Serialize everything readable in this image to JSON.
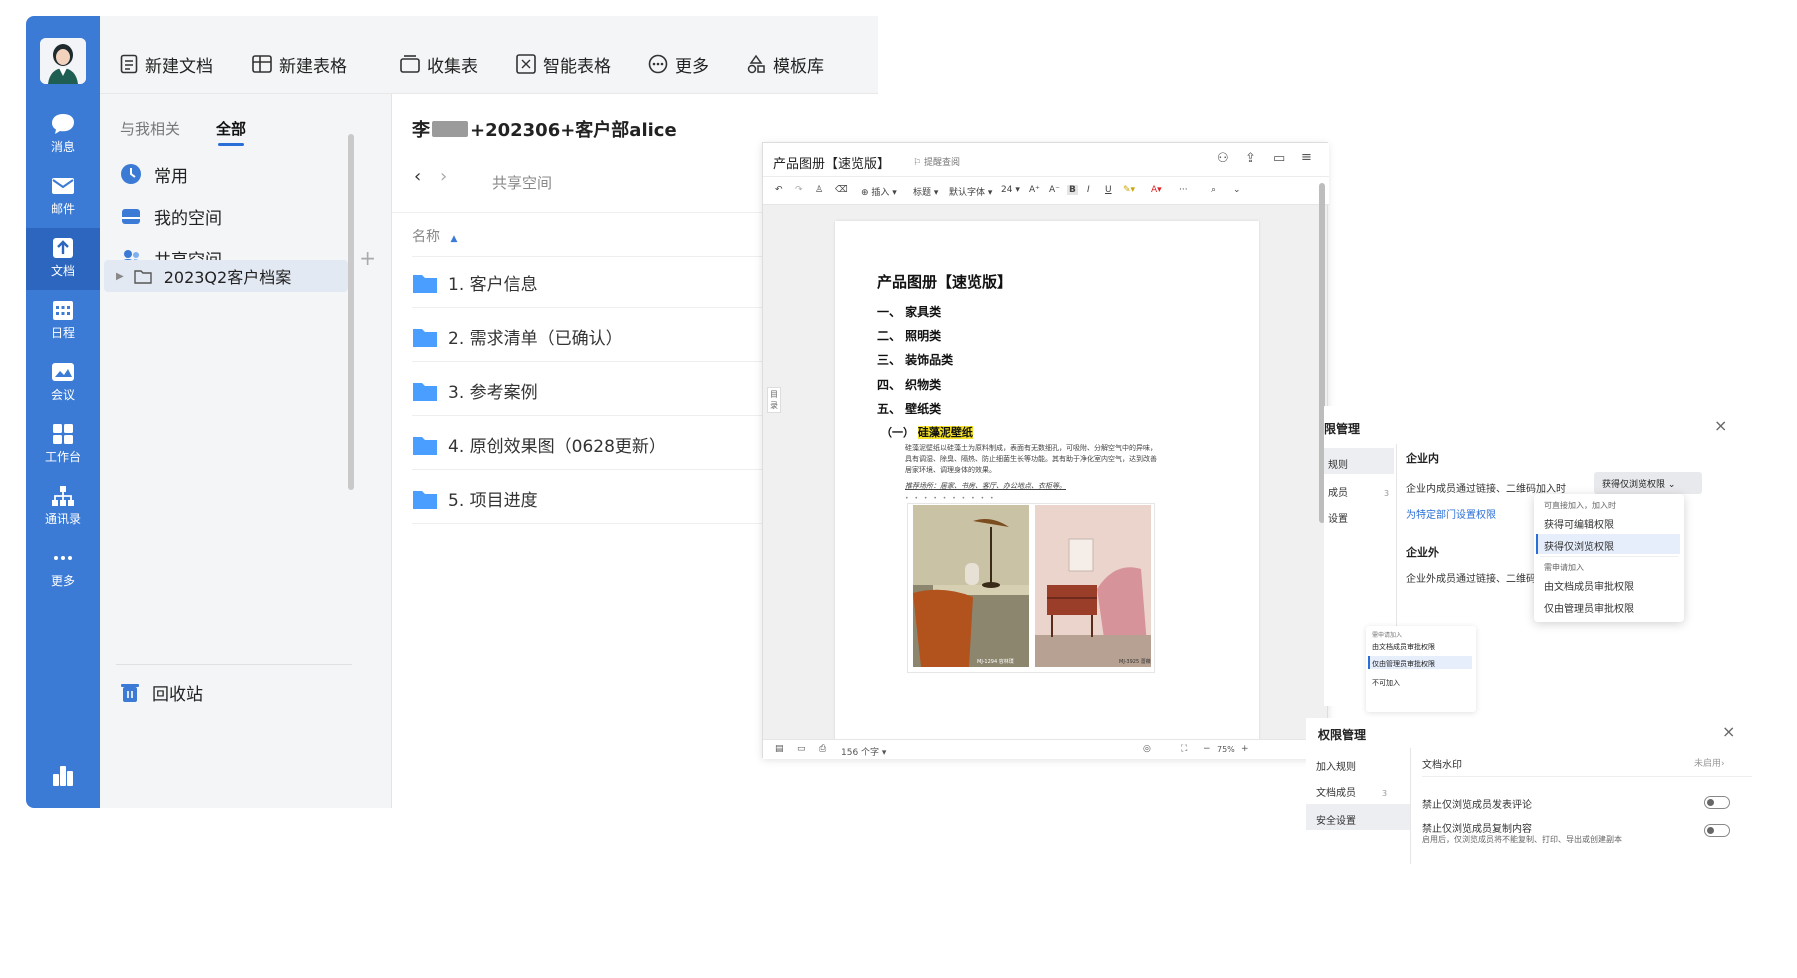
{
  "rail": {
    "items": [
      {
        "label": "消息",
        "icon": "chat-icon"
      },
      {
        "label": "邮件",
        "icon": "mail-icon"
      },
      {
        "label": "文档",
        "icon": "doc-icon"
      },
      {
        "label": "日程",
        "icon": "calendar-icon"
      },
      {
        "label": "会议",
        "icon": "meeting-icon"
      },
      {
        "label": "工作台",
        "icon": "grid-icon"
      },
      {
        "label": "通讯录",
        "icon": "contacts-icon"
      },
      {
        "label": "更多",
        "icon": "more-icon"
      }
    ],
    "active": "文档"
  },
  "toolbar": {
    "new_doc": "新建文档",
    "new_sheet": "新建表格",
    "collect": "收集表",
    "smart_sheet": "智能表格",
    "more": "更多",
    "templates": "模板库"
  },
  "left": {
    "tabs": [
      "与我相关",
      "全部"
    ],
    "active_tab": "全部",
    "common": "常用",
    "my_space": "我的空间",
    "shared_space": "共享空间",
    "folder": "2023Q2客户档案",
    "trash": "回收站"
  },
  "right": {
    "title_prefix": "李",
    "title_suffix": "+202306+客户部alice",
    "breadcrumb": "共享空间",
    "col_name": "名称",
    "files": [
      "1. 客户信息",
      "2. 需求清单（已确认）",
      "3. 参考案例",
      "4. 原创效果图（0628更新）",
      "5. 项目进度"
    ]
  },
  "doc": {
    "tab_title": "产品图册【速览版】",
    "tab_tag": "提醒查阅",
    "fmt": {
      "insert": "插入",
      "heading": "标题",
      "font": "默认字体",
      "size": "24"
    },
    "toc": "目录",
    "title": "产品图册【速览版】",
    "sections": [
      "一、 家具类",
      "二、 照明类",
      "三、 装饰品类",
      "四、 织物类",
      "五、 壁纸类"
    ],
    "sub": "（一）",
    "sub_hl": "硅藻泥壁纸",
    "body": "硅藻泥壁纸以硅藻土为原料制成，表面有无数细孔，可吸附、分解空气中的异味，具有调湿、除臭、隔热、防止细菌生长等功能。其有助于净化室内空气，达到改善居家环境、调理身体的效果。",
    "recommend": "推荐场所：居家、书房、客厅、办公地点、衣柜等。",
    "img1_tag": "MJ-1294 容林璞",
    "img2_tag": "MJ-3925 蔷薇",
    "word_count": "156 个字",
    "zoom": "75%"
  },
  "perm1": {
    "title": "限管理",
    "nav": [
      "规则",
      "成员",
      "设置"
    ],
    "nav_count": "3",
    "inside": "企业内",
    "inside_desc": "企业内成员通过链接、二维码加入时",
    "select": "获得仅浏览权限",
    "dept_link": "为特定部门设置权限",
    "outside": "企业外",
    "outside_desc": "企业外成员通过链接、二维码加入",
    "dd_group1": "可直接加入，加入时",
    "dd_opt1": "获得可编辑权限",
    "dd_opt2": "获得仅浏览权限",
    "dd_group2": "需申请加入",
    "dd_opt3": "由文档成员审批权限",
    "dd_opt4": "仅由管理员审批权限",
    "dd2_group": "需申请加入",
    "dd2_opt1": "由文档成员审批权限",
    "dd2_opt2": "仅由管理员审批权限",
    "dd2_opt3": "不可加入"
  },
  "perm2": {
    "title": "权限管理",
    "nav": [
      "加入规则",
      "文档成员",
      "安全设置"
    ],
    "nav_count": "3",
    "watermark": "文档水印",
    "watermark_state": "未启用",
    "opt1": "禁止仅浏览成员发表评论",
    "opt2": "禁止仅浏览成员复制内容",
    "opt2_desc": "启用后，仅浏览成员将不能复制、打印、导出或创建副本"
  },
  "colors": {
    "rail": "#3b7bd6",
    "accent": "#2a6fd8",
    "folder": "#4a9eff",
    "highlight": "#f5e32a"
  }
}
